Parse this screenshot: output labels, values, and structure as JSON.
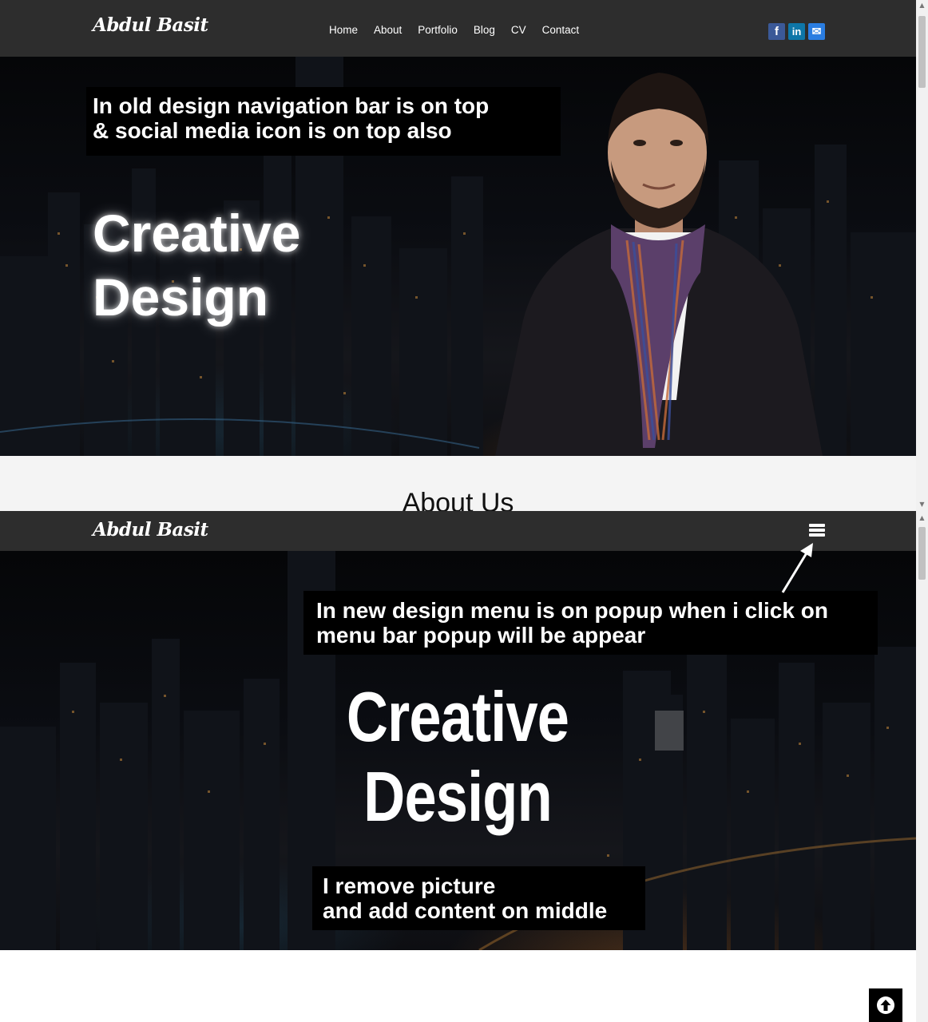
{
  "old_design": {
    "brand": "Abdul Basit",
    "nav": [
      "Home",
      "About",
      "Portfolio",
      "Blog",
      "CV",
      "Contact"
    ],
    "social_icons": [
      "facebook-icon",
      "linkedin-icon",
      "mail-icon"
    ],
    "social_glyphs": {
      "facebook": "f",
      "linkedin": "in",
      "mail": "✉"
    },
    "note_line1": "In old design navigation bar is on top",
    "note_line2": "& social media icon is on top also",
    "hero_line1": "Creative",
    "hero_line2": "Design",
    "about_heading": "About Us"
  },
  "new_design": {
    "brand": "Abdul Basit",
    "menu_icon": "hamburger-menu-icon",
    "note_top_line1": "In new design menu is on popup when i click on",
    "note_top_line2": "menu bar popup will be appear",
    "hero_line1": "Creative",
    "hero_line2": "Design",
    "note_bottom_line1": "I remove picture",
    "note_bottom_line2": "and add content on middle",
    "back_to_top_icon": "arrow-up-icon"
  },
  "colors": {
    "navbar": "#2d2d2d",
    "facebook": "#3b5998",
    "linkedin": "#0e76a8",
    "mail": "#2a7de1"
  }
}
